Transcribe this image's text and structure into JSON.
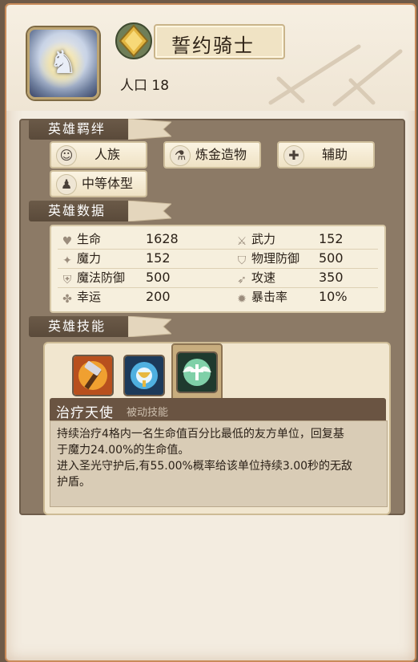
{
  "hero": {
    "name": "誓约骑士",
    "population": "人口 18"
  },
  "sections": {
    "bonds_title": "英雄羁绊",
    "stats_title": "英雄数据",
    "skills_title": "英雄技能"
  },
  "bonds": [
    {
      "label": "人族",
      "icon": "person-icon"
    },
    {
      "label": "炼金造物",
      "icon": "flask-icon"
    },
    {
      "label": "辅助",
      "icon": "cross-shield-icon"
    },
    {
      "label": "中等体型",
      "icon": "body-size-icon"
    }
  ],
  "stats": {
    "hp_label": "生命",
    "hp": "1628",
    "attack_label": "武力",
    "attack": "152",
    "magic_label": "魔力",
    "magic": "152",
    "armor_label": "物理防御",
    "armor": "500",
    "mres_label": "魔法防御",
    "mres": "500",
    "aspd_label": "攻速",
    "aspd": "350",
    "luck_label": "幸运",
    "luck": "200",
    "crit_label": "暴击率",
    "crit": "10%"
  },
  "skill": {
    "name": "治疗天使",
    "type": "被动技能",
    "desc_line1": "持续治疗4格内一名生命值百分比最低的友方单位，回复基",
    "desc_line2": "于魔力24.00%的生命值。",
    "desc_line3": "进入圣光守护后,有55.00%概率给该单位持续3.00秒的无敌",
    "desc_line4": "护盾。"
  },
  "colors": {
    "accent": "#6a5442",
    "paper": "#f3ece0",
    "panel": "#8c7a66"
  }
}
